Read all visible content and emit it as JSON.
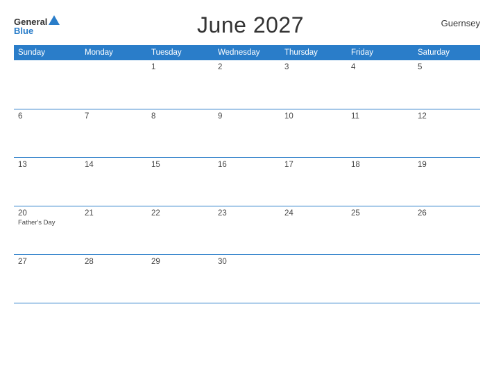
{
  "header": {
    "logo_general": "General",
    "logo_blue": "Blue",
    "title": "June 2027",
    "region": "Guernsey"
  },
  "calendar": {
    "days_of_week": [
      "Sunday",
      "Monday",
      "Tuesday",
      "Wednesday",
      "Thursday",
      "Friday",
      "Saturday"
    ],
    "weeks": [
      [
        {
          "num": "",
          "event": ""
        },
        {
          "num": "",
          "event": ""
        },
        {
          "num": "1",
          "event": ""
        },
        {
          "num": "2",
          "event": ""
        },
        {
          "num": "3",
          "event": ""
        },
        {
          "num": "4",
          "event": ""
        },
        {
          "num": "5",
          "event": ""
        }
      ],
      [
        {
          "num": "6",
          "event": ""
        },
        {
          "num": "7",
          "event": ""
        },
        {
          "num": "8",
          "event": ""
        },
        {
          "num": "9",
          "event": ""
        },
        {
          "num": "10",
          "event": ""
        },
        {
          "num": "11",
          "event": ""
        },
        {
          "num": "12",
          "event": ""
        }
      ],
      [
        {
          "num": "13",
          "event": ""
        },
        {
          "num": "14",
          "event": ""
        },
        {
          "num": "15",
          "event": ""
        },
        {
          "num": "16",
          "event": ""
        },
        {
          "num": "17",
          "event": ""
        },
        {
          "num": "18",
          "event": ""
        },
        {
          "num": "19",
          "event": ""
        }
      ],
      [
        {
          "num": "20",
          "event": "Father's Day"
        },
        {
          "num": "21",
          "event": ""
        },
        {
          "num": "22",
          "event": ""
        },
        {
          "num": "23",
          "event": ""
        },
        {
          "num": "24",
          "event": ""
        },
        {
          "num": "25",
          "event": ""
        },
        {
          "num": "26",
          "event": ""
        }
      ],
      [
        {
          "num": "27",
          "event": ""
        },
        {
          "num": "28",
          "event": ""
        },
        {
          "num": "29",
          "event": ""
        },
        {
          "num": "30",
          "event": ""
        },
        {
          "num": "",
          "event": ""
        },
        {
          "num": "",
          "event": ""
        },
        {
          "num": "",
          "event": ""
        }
      ]
    ]
  }
}
